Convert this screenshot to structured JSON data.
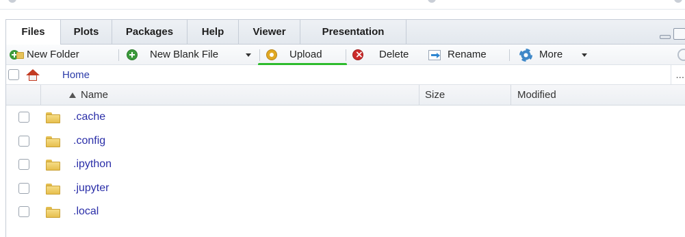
{
  "tabs": [
    {
      "label": "Files",
      "active": true
    },
    {
      "label": "Plots",
      "active": false
    },
    {
      "label": "Packages",
      "active": false
    },
    {
      "label": "Help",
      "active": false
    },
    {
      "label": "Viewer",
      "active": false
    },
    {
      "label": "Presentation",
      "active": false
    }
  ],
  "toolbar": {
    "new_folder": "New Folder",
    "new_blank_file": "New Blank File",
    "upload": "Upload",
    "delete": "Delete",
    "rename": "Rename",
    "more": "More"
  },
  "path": {
    "home": "Home",
    "overflow": "..."
  },
  "columns": {
    "name": "Name",
    "size": "Size",
    "modified": "Modified"
  },
  "files": [
    {
      "name": ".cache",
      "type": "folder"
    },
    {
      "name": ".config",
      "type": "folder"
    },
    {
      "name": ".ipython",
      "type": "folder"
    },
    {
      "name": ".jupyter",
      "type": "folder"
    },
    {
      "name": ".local",
      "type": "folder"
    }
  ],
  "colors": {
    "highlight_underline": "#2dbb2d",
    "link": "#2a2ea8",
    "folder": "#e6bf4e"
  },
  "icons": {
    "new_folder": "folder-plus-icon",
    "new_blank_file": "add-icon",
    "upload": "upload-icon",
    "delete": "delete-icon",
    "rename": "rename-icon",
    "more": "gear-icon",
    "home": "home-icon",
    "file": "folder-icon"
  }
}
